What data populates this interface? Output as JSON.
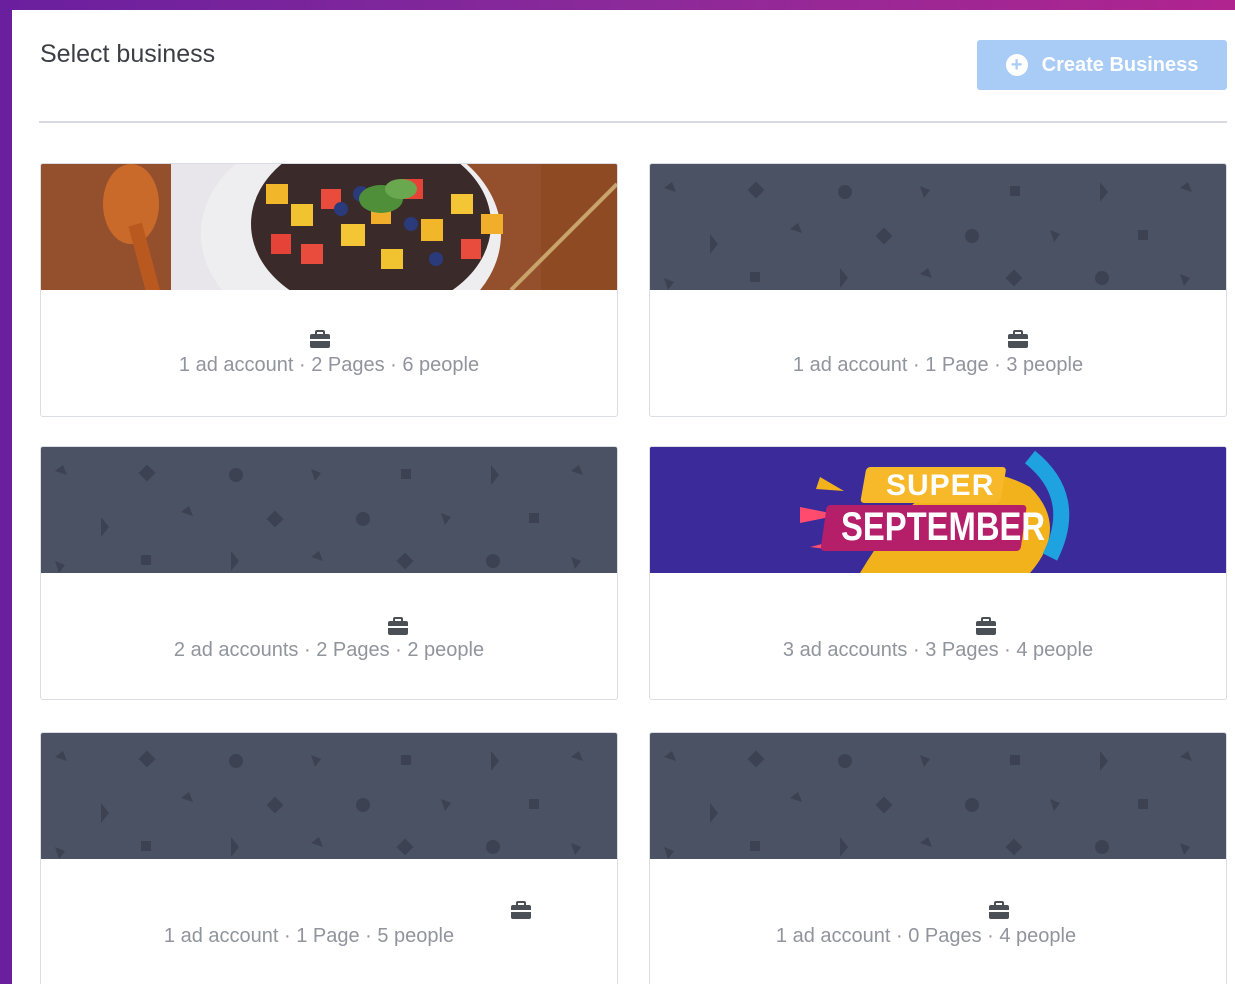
{
  "header": {
    "title": "Select business",
    "create_button_label": "Create Business"
  },
  "businesses": [
    {
      "cover": "fruit-bowl-photo",
      "stats": "1 ad account · 2 Pages · 6 people"
    },
    {
      "cover": "default-pattern",
      "stats": "1 ad account · 1 Page · 3 people"
    },
    {
      "cover": "default-pattern",
      "stats": "2 ad accounts · 2 Pages · 2 people"
    },
    {
      "cover": "super-september-banner",
      "stats": "3 ad accounts · 3 Pages · 4 people",
      "banner_top": "SUPER",
      "banner_bottom": "SEPTEMBER"
    },
    {
      "cover": "default-pattern",
      "stats": "1 ad account · 1 Page · 5 people"
    },
    {
      "cover": "default-pattern",
      "stats": "1 ad account · 0 Pages · 4 people"
    }
  ],
  "colors": {
    "accent_button": "#a9ccf6",
    "pattern_bg": "#4b5263",
    "banner_bg": "#3b2b9a"
  }
}
